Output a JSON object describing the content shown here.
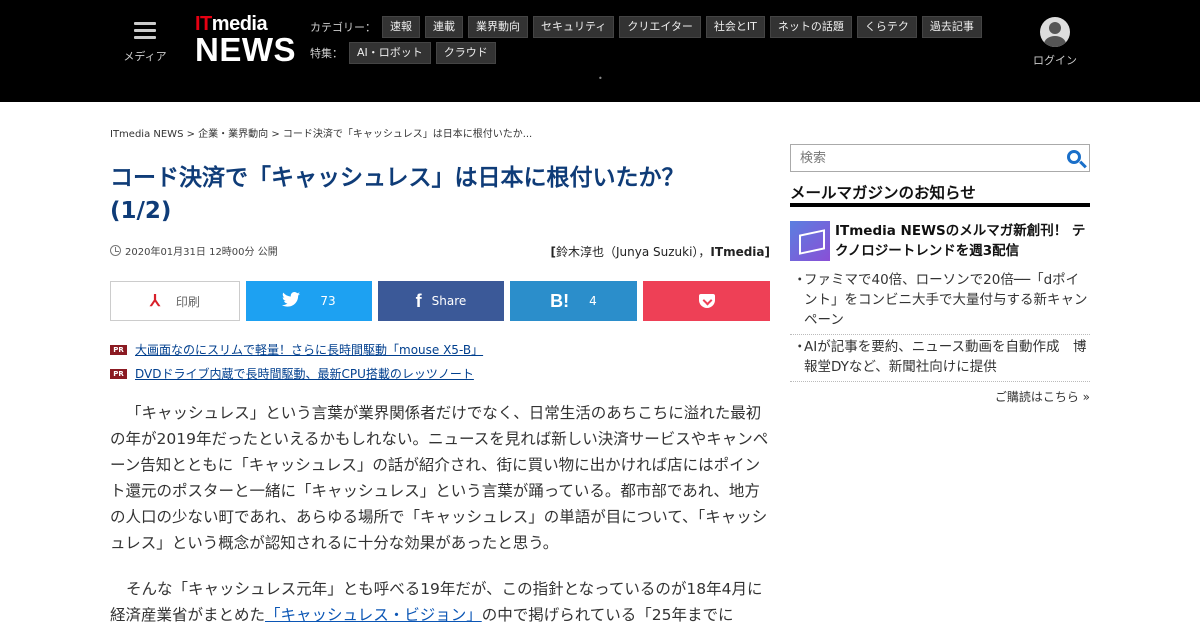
{
  "header": {
    "menu_label": "メディア",
    "logo_it": "IT",
    "logo_media": "media",
    "logo_news": "NEWS",
    "category_label": "カテゴリー：",
    "categories": [
      "速報",
      "連載",
      "業界動向",
      "セキュリティ",
      "クリエイター",
      "社会とIT",
      "ネットの話題",
      "くらテク",
      "過去記事"
    ],
    "feature_label": "特集：",
    "features": [
      "AI・ロボット",
      "クラウド"
    ],
    "login_label": "ログイン"
  },
  "breadcrumb": "ITmedia NEWS > 企業・業界動向 > コード決済で「キャッシュレス」は日本に根付いたか...",
  "article": {
    "title": "コード決済で「キャッシュレス」は日本に根付いたか？ (1/2)",
    "date": "2020年01月31日 12時00分 公開",
    "author_open": "[",
    "author_name": "鈴木淳也（Junya Suzuki）",
    "author_sep": "，",
    "author_outlet": "ITmedia",
    "author_close": "]"
  },
  "share": {
    "print_label": "印刷",
    "twitter_count": "73",
    "facebook_label": "Share",
    "hatena_mark": "B!",
    "hatena_count": "4"
  },
  "pr": {
    "tag": "PR",
    "links": [
      "大画面なのにスリムで軽量！さらに長時間駆動「mouse X5-B」",
      "DVDドライブ内蔵で長時間駆動、最新CPU搭載のレッツノート"
    ]
  },
  "body": {
    "p1": "「キャッシュレス」という言葉が業界関係者だけでなく、日常生活のあちこちに溢れた最初の年が2019年だったといえるかもしれない。ニュースを見れば新しい決済サービスやキャンペーン告知とともに「キャッシュレス」の話が紹介され、街に買い物に出かければ店にはポイント還元のポスターと一緒に「キャッシュレス」という言葉が踊っている。都市部であれ、地方の人口の少ない町であれ、あらゆる場所で「キャッシュレス」の単語が目について、「キャッシュレス」という概念が認知されるに十分な効果があったと思う。",
    "p2_a": "そんな「キャッシュレス元年」とも呼べる19年だが、この指針となっているのが18年4月に経済産業省がまとめた",
    "p2_link": "「キャッシュレス・ビジョン」",
    "p2_b": "の中で掲げられている「25年までに"
  },
  "sidebar": {
    "search_placeholder": "検索",
    "newsletter_heading": "メールマガジンのお知らせ",
    "newsletter_feature": "ITmedia NEWSのメルマガ新創刊！ テクノロジートレンドを週3配信",
    "bullet": "・",
    "items": [
      "ファミマで40倍、ローソンで20倍──「dポイント」をコンビニ大手で大量付与する新キャンペーン",
      "AIが記事を要約、ニュース動画を自動作成　博報堂DYなど、新聞社向けに提供"
    ],
    "more_link": "ご購読はこちら »"
  }
}
